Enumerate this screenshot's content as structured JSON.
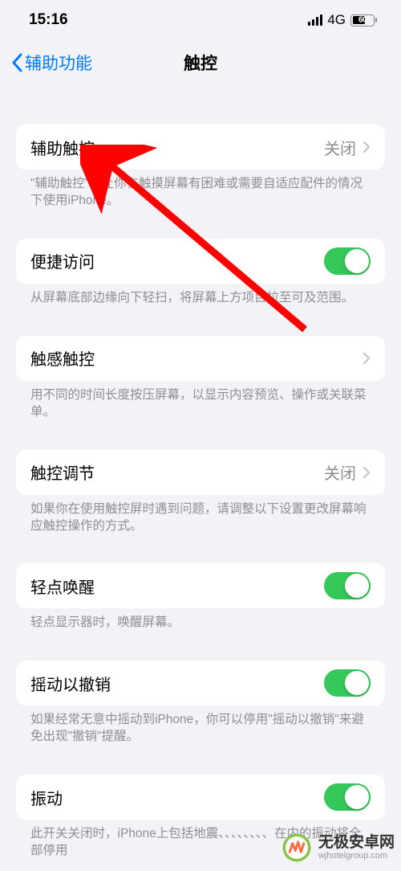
{
  "status": {
    "time": "15:16",
    "network": "4G",
    "battery": "60"
  },
  "nav": {
    "back": "辅助功能",
    "title": "触控"
  },
  "rows": {
    "assistive_touch": {
      "label": "辅助触控",
      "value": "关闭"
    },
    "reachability": {
      "label": "便捷访问"
    },
    "haptic_touch": {
      "label": "触感触控"
    },
    "touch_accommodations": {
      "label": "触控调节",
      "value": "关闭"
    },
    "tap_to_wake": {
      "label": "轻点唤醒"
    },
    "shake_to_undo": {
      "label": "摇动以撤销"
    },
    "vibration": {
      "label": "振动"
    }
  },
  "footers": {
    "assistive_touch": "\"辅助触控\"可让你在触摸屏幕有困难或需要自适应配件的情况下使用iPhone。",
    "reachability": "从屏幕底部边缘向下轻扫，将屏幕上方项目拉至可及范围。",
    "haptic_touch": "用不同的时间长度按压屏幕，以显示内容预览、操作或关联菜单。",
    "touch_accommodations": "如果你在使用触控屏时遇到问题，请调整以下设置更改屏幕响应触控操作的方式。",
    "tap_to_wake": "轻点显示器时，唤醒屏幕。",
    "shake_to_undo": "如果经常无意中摇动到iPhone，你可以停用\"摇动以撤销\"来避免出现\"撤销\"提醒。",
    "vibration": "此开关关闭时，iPhone上包括地震、、、、、、、、在内的振动将全部停用"
  },
  "watermark": {
    "title": "无极安卓网",
    "url": "wjhotelgroup.com"
  }
}
